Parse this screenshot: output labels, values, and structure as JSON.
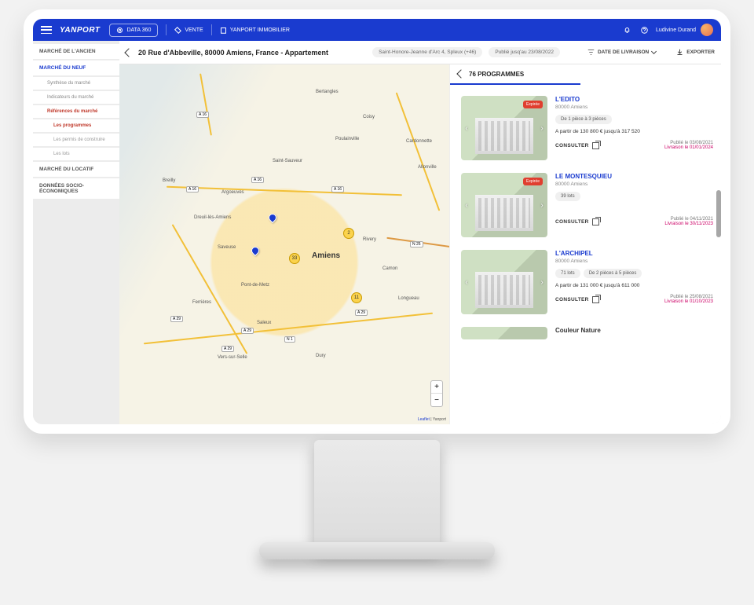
{
  "header": {
    "logo": "YANPORT",
    "data360": "DATA 360",
    "vente": "VENTE",
    "yan_immo": "YANPORT IMMOBILIER",
    "username": "Ludivine Durand"
  },
  "sidebar": {
    "ancien": "MARCHÉ DE L'ANCIEN",
    "neuf": "MARCHÉ DU NEUF",
    "synthese": "Synthèse du marché",
    "indicateurs": "Indicateurs du marché",
    "references": "Références du marché",
    "programmes": "Les programmes",
    "permis": "Les permis de construire",
    "lots": "Les lots",
    "locatif": "MARCHÉ DU LOCATIF",
    "socio": "DONNÉES SOCIO-ÉCONOMIQUES"
  },
  "breadcrumb": {
    "title": "20 Rue d'Abbeville, 80000 Amiens, France - Appartement",
    "chip1": "Saint-Honore-Jeanne d'Arc 4, Spleux (+46)",
    "chip2": "Publié jusq'au 23/08/2022",
    "sort": "DATE DE LIVRAISON",
    "export": "EXPORTER"
  },
  "map": {
    "labels": {
      "amiens": "Amiens",
      "bertangles": "Bertangles",
      "coisy": "Coisy",
      "rivery": "Rivery",
      "camon": "Camon",
      "longueau": "Longueau",
      "dury": "Dury",
      "saleux": "Saleux",
      "saveuse": "Saveuse",
      "dreuil": "Dreuil-lès-Amiens",
      "argoeuves": "Argoeuves",
      "breilly": "Breilly",
      "poulainville": "Poulainville",
      "pontdemetz": "Pont-de-Metz",
      "verssurselle": "Vers-sur-Selle",
      "ferrieres": "Ferrières",
      "saintsauveur": "Saint-Sauveur",
      "allonville": "Allonville",
      "cardonnette": "Cardonnette"
    },
    "roads": {
      "a16": "A 16",
      "a29": "A 29",
      "n25": "N 25",
      "n1": "N 1"
    },
    "clusters": {
      "c1": "2",
      "c2": "33",
      "c3": "11"
    },
    "zoom_in": "+",
    "zoom_out": "−",
    "attrib_leaflet": "Leaflet",
    "attrib_rest": " | Yanport"
  },
  "results": {
    "title": "76 PROGRAMMES",
    "badge_expiree": "Expirée",
    "consult": "CONSULTER",
    "cards": [
      {
        "title": "L'EDITO",
        "sub": "80000 Amiens",
        "tags": [
          "De 1 pièce à 3 pièces"
        ],
        "price": "A partir de 130 800 €  jusqu'à 317 520",
        "pub": "Publié le 03/08/2021",
        "liv": "Livraison le 01/01/2024",
        "expired": true
      },
      {
        "title": "LE MONTESQUIEU",
        "sub": "80000 Amiens",
        "tags": [
          "39 lots"
        ],
        "price": "",
        "pub": "Publié le 04/11/2021",
        "liv": "Livraison le 30/11/2023",
        "expired": true
      },
      {
        "title": "L'ARCHIPEL",
        "sub": "80000 Amiens",
        "tags": [
          "71 lots",
          "De 2 pièces à 5 pièces"
        ],
        "price": "A partir de 131 000 €  jusqu'à 611 000",
        "pub": "Publié le 25/08/2021",
        "liv": "Livraison le 01/10/2023",
        "expired": false
      },
      {
        "title": "Couleur Nature",
        "sub": "",
        "tags": [],
        "price": "",
        "pub": "",
        "liv": "",
        "expired": false
      }
    ]
  }
}
